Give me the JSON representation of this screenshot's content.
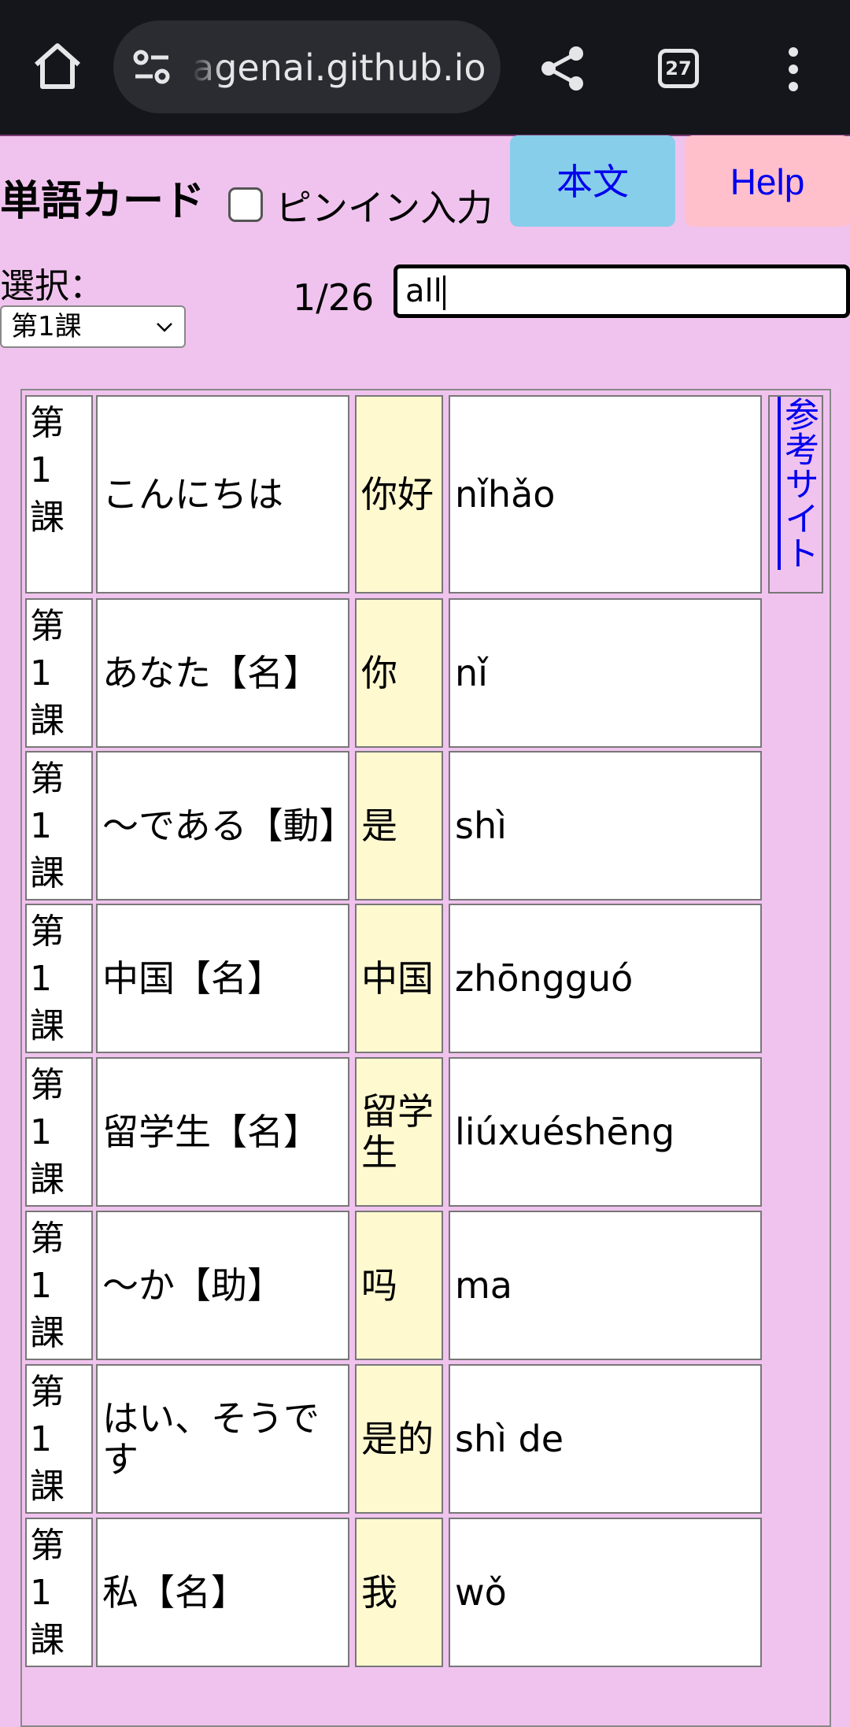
{
  "browser": {
    "url": "agenai.github.io",
    "tab_count": "27",
    "icons": [
      "home-icon",
      "site-settings-icon",
      "share-icon",
      "tabs-icon",
      "more-icon"
    ]
  },
  "header": {
    "title": "単語カード",
    "pinyin_label": "ピンイン入力",
    "pinyin_checked": false,
    "honbun_button": "本文",
    "help_button": "Help"
  },
  "controls": {
    "select_label": "選択：",
    "selected_lesson": "第1課",
    "counter": "1/26",
    "search_value": "all"
  },
  "reference_link": "参考サイト",
  "rows": [
    {
      "lesson": "第1課",
      "japanese": "こんにちは",
      "chinese": "你好",
      "pinyin": "nǐhǎo"
    },
    {
      "lesson": "第1課",
      "japanese": "あなた【名】",
      "chinese": "你",
      "pinyin": "nǐ"
    },
    {
      "lesson": "第1課",
      "japanese": "～である【動】",
      "chinese": "是",
      "pinyin": "shì"
    },
    {
      "lesson": "第1課",
      "japanese": "中国【名】",
      "chinese": "中国",
      "pinyin": "zhōngguó"
    },
    {
      "lesson": "第1課",
      "japanese": "留学生【名】",
      "chinese": "留学生",
      "pinyin": "liúxuéshēng"
    },
    {
      "lesson": "第1課",
      "japanese": "～か【助】",
      "chinese": "吗",
      "pinyin": "ma"
    },
    {
      "lesson": "第1課",
      "japanese": "はい、そうです",
      "chinese": "是的",
      "pinyin": "shì de"
    },
    {
      "lesson": "第1課",
      "japanese": "私【名】",
      "chinese": "我",
      "pinyin": "wǒ"
    }
  ],
  "colors": {
    "page_bg": "#f0c3ee",
    "chinese_cell_bg": "#fff9d0",
    "honbun_bg": "#87ceeb",
    "help_bg": "#ffc0cb",
    "link": "#0000ee"
  }
}
